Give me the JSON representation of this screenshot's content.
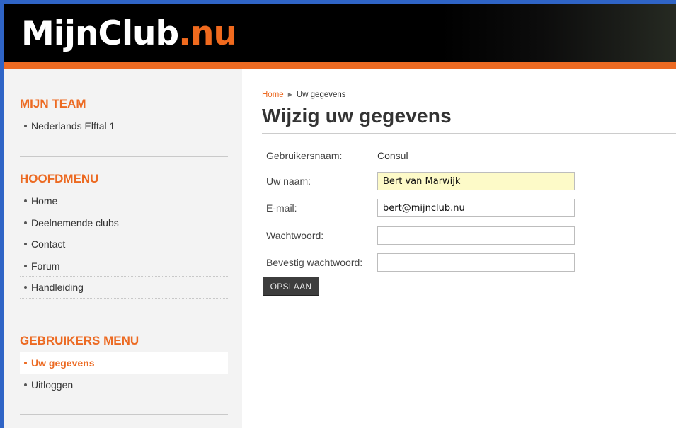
{
  "header": {
    "logo_main": "MijnClub",
    "logo_accent": ".nu"
  },
  "sidebar": {
    "team": {
      "title": "MIJN TEAM",
      "items": [
        {
          "label": "Nederlands Elftal 1"
        }
      ]
    },
    "main_menu": {
      "title": "HOOFDMENU",
      "items": [
        {
          "label": "Home"
        },
        {
          "label": "Deelnemende clubs"
        },
        {
          "label": "Contact"
        },
        {
          "label": "Forum"
        },
        {
          "label": "Handleiding"
        }
      ]
    },
    "user_menu": {
      "title": "GEBRUIKERS MENU",
      "items": [
        {
          "label": "Uw gegevens",
          "active": true
        },
        {
          "label": "Uitloggen"
        }
      ]
    }
  },
  "breadcrumb": {
    "home": "Home",
    "current": "Uw gegevens"
  },
  "page_title": "Wijzig uw gegevens",
  "form": {
    "username_label": "Gebruikersnaam:",
    "username_value": "Consul",
    "name_label": "Uw naam:",
    "name_value": "Bert van Marwijk",
    "email_label": "E-mail:",
    "email_value": "bert@mijnclub.nu",
    "password_label": "Wachtwoord:",
    "password_value": "",
    "confirm_label": "Bevestig wachtwoord:",
    "confirm_value": "",
    "save_label": "OPSLAAN"
  },
  "colors": {
    "accent": "#ec6a22",
    "header_bg": "#000000",
    "frame": "#2f64c6"
  }
}
